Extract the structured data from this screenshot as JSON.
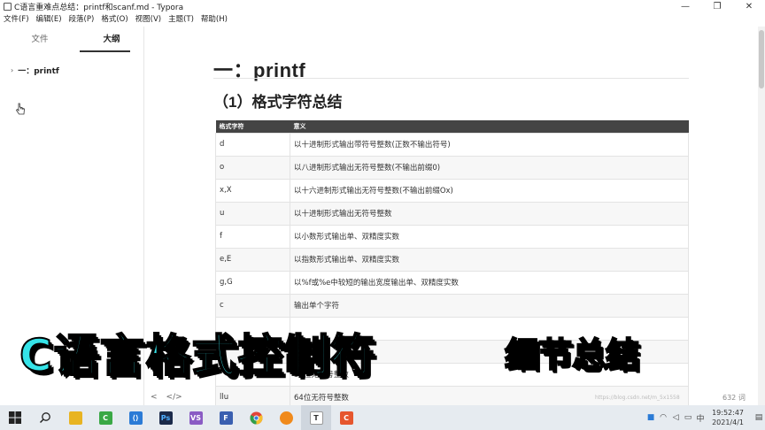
{
  "window": {
    "title": "C语言重难点总结：printf和scanf.md - Typora",
    "controls": [
      "—",
      "❐",
      "✕"
    ]
  },
  "menu": [
    "文件(F)",
    "编辑(E)",
    "段落(P)",
    "格式(O)",
    "视图(V)",
    "主题(T)",
    "帮助(H)"
  ],
  "sidebar": {
    "tabs": [
      "文件",
      "大纲"
    ],
    "active_tab": "大纲",
    "outline": [
      {
        "label": "一：printf",
        "collapsed": true
      }
    ]
  },
  "document": {
    "h1": "一：printf",
    "h2": "（1）格式字符总结",
    "table": {
      "headers": [
        "格式字符",
        "意义"
      ],
      "rows": [
        [
          "d",
          "以十进制形式输出带符号整数(正数不输出符号)"
        ],
        [
          "o",
          "以八进制形式输出无符号整数(不输出前缀0)"
        ],
        [
          "x,X",
          "以十六进制形式输出无符号整数(不输出前缀Ox)"
        ],
        [
          "u",
          "以十进制形式输出无符号整数"
        ],
        [
          "f",
          "以小数形式输出单、双精度实数"
        ],
        [
          "e,E",
          "以指数形式输出单、双精度实数"
        ],
        [
          "g,G",
          "以%f或%e中较短的输出宽度输出单、双精度实数"
        ],
        [
          "c",
          "输出单个字符"
        ],
        [
          "",
          ""
        ],
        [
          "",
          ""
        ],
        [
          "",
          "32位无符号整数"
        ],
        [
          "llu",
          "64位无符号整数"
        ]
      ]
    }
  },
  "footer": {
    "back": "<",
    "source_toggle": "</>",
    "word_count": "632 词",
    "watermark": "https://blog.csdn.net/m_5x1558"
  },
  "overlay": {
    "title": "C语言格式控制符",
    "subtitle": "细节总结",
    "title_color": "#35e3e8",
    "subtitle_color": "#f2f01c"
  },
  "taskbar": {
    "apps": [
      {
        "name": "windows-start-icon",
        "color": "#1a73c8",
        "glyph": "⊞"
      },
      {
        "name": "search-icon",
        "color": "#444",
        "glyph": "⌕"
      },
      {
        "name": "file-explorer-icon",
        "color": "#e8b422",
        "glyph": ""
      },
      {
        "name": "camtasia-icon",
        "color": "#3aa845",
        "glyph": "C"
      },
      {
        "name": "vscode-icon",
        "color": "#2b7bd6",
        "glyph": "⟨⟩"
      },
      {
        "name": "photoshop-icon",
        "color": "#1b2a4a",
        "glyph": "Ps"
      },
      {
        "name": "visual-studio-icon",
        "color": "#8a5bc4",
        "glyph": "VS"
      },
      {
        "name": "app-f-icon",
        "color": "#3a5fb0",
        "glyph": "F"
      },
      {
        "name": "chrome-icon",
        "color": "#e2453a",
        "glyph": "●"
      },
      {
        "name": "microphone-app-icon",
        "color": "#f08a1c",
        "glyph": "🎙"
      },
      {
        "name": "typora-icon",
        "color": "#555",
        "glyph": "T"
      },
      {
        "name": "recorder-icon",
        "color": "#e6562e",
        "glyph": "C"
      }
    ],
    "time": "19:52:47",
    "date": "2021/4/1",
    "ime": "中"
  }
}
